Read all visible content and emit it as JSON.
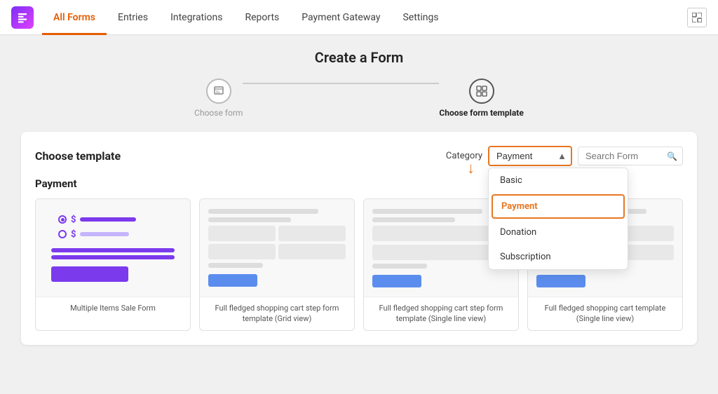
{
  "app": {
    "logo_alt": "Fluent Forms Logo"
  },
  "nav": {
    "items": [
      {
        "id": "all-forms",
        "label": "All Forms",
        "active": true
      },
      {
        "id": "entries",
        "label": "Entries",
        "active": false
      },
      {
        "id": "integrations",
        "label": "Integrations",
        "active": false
      },
      {
        "id": "reports",
        "label": "Reports",
        "active": false
      },
      {
        "id": "payment-gateway",
        "label": "Payment Gateway",
        "active": false
      },
      {
        "id": "settings",
        "label": "Settings",
        "active": false
      }
    ]
  },
  "page": {
    "title": "Create a Form"
  },
  "steps": [
    {
      "id": "choose-form",
      "label": "Choose form",
      "active": false
    },
    {
      "id": "choose-template",
      "label": "Choose form template",
      "active": true
    }
  ],
  "template_section": {
    "title": "Choose template",
    "category_label": "Category",
    "category_value": "Payment",
    "search_placeholder": "Search Form",
    "section_heading": "Payment",
    "dropdown_options": [
      {
        "id": "basic",
        "label": "Basic",
        "selected": false
      },
      {
        "id": "payment",
        "label": "Payment",
        "selected": true
      },
      {
        "id": "donation",
        "label": "Donation",
        "selected": false
      },
      {
        "id": "subscription",
        "label": "Subscription",
        "selected": false
      }
    ],
    "templates": [
      {
        "id": "multiple-items",
        "label": "Multiple Items Sale Form"
      },
      {
        "id": "grid-view",
        "label": "Full fledged shopping cart step form template (Grid view)"
      },
      {
        "id": "single-line",
        "label": "Full fledged shopping cart step form template (Single line view)"
      },
      {
        "id": "single-line-2",
        "label": "Full fledged shopping cart template (Single line view)"
      }
    ]
  }
}
